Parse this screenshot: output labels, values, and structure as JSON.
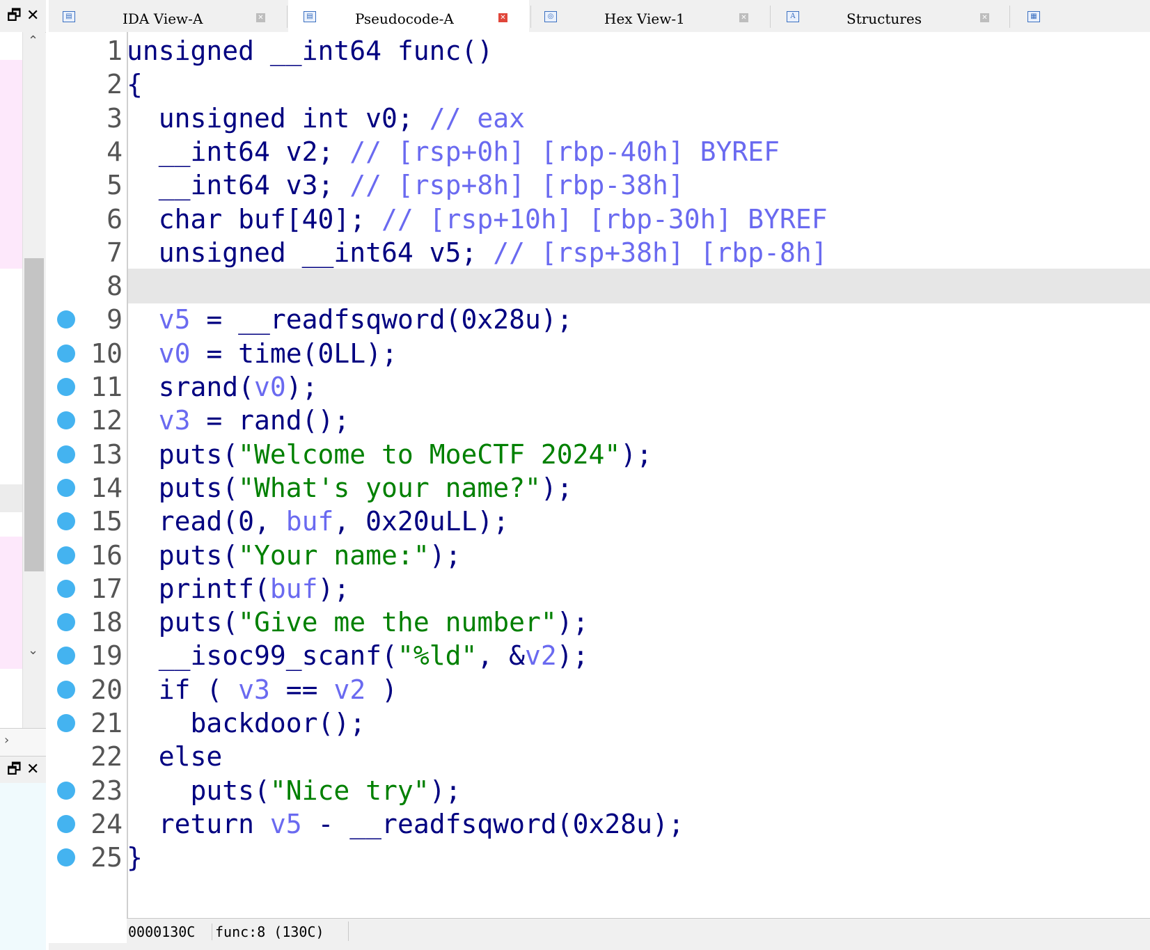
{
  "left_panel": {
    "restore_glyph": "🗗",
    "close_glyph": "✕",
    "scroll_up_glyph": "⌃",
    "scroll_down_glyph": "⌄",
    "scroll_right_glyph": "›"
  },
  "tabs": [
    {
      "label": "IDA View-A",
      "icon": "ida-view-icon",
      "active": false,
      "close_color": "#bdbdbd"
    },
    {
      "label": "Pseudocode-A",
      "icon": "pseudocode-icon",
      "active": true,
      "close_color": "#e0463a"
    },
    {
      "label": "Hex View-1",
      "icon": "hex-view-icon",
      "active": false,
      "close_color": "#bdbdbd"
    },
    {
      "label": "Structures",
      "icon": "structures-icon",
      "active": false,
      "close_color": "#bdbdbd"
    }
  ],
  "colors": {
    "keyword": "#000080",
    "variable": "#6a6af0",
    "string": "#008000",
    "breakpoint": "#44b3f0",
    "current_line": "#e6e6e6"
  },
  "code": {
    "current_line": 8,
    "lines": [
      {
        "n": "1",
        "bp": false,
        "tokens": [
          [
            "k",
            "unsigned __int64 func"
          ],
          [
            "k",
            "()"
          ]
        ]
      },
      {
        "n": "2",
        "bp": false,
        "tokens": [
          [
            "k",
            "{"
          ]
        ]
      },
      {
        "n": "3",
        "bp": false,
        "tokens": [
          [
            "k",
            "  unsigned int v0; "
          ],
          [
            "v",
            "// eax"
          ]
        ]
      },
      {
        "n": "4",
        "bp": false,
        "tokens": [
          [
            "k",
            "  __int64 v2; "
          ],
          [
            "v",
            "// [rsp+0h] [rbp-40h] BYREF"
          ]
        ]
      },
      {
        "n": "5",
        "bp": false,
        "tokens": [
          [
            "k",
            "  __int64 v3; "
          ],
          [
            "v",
            "// [rsp+8h] [rbp-38h]"
          ]
        ]
      },
      {
        "n": "6",
        "bp": false,
        "tokens": [
          [
            "k",
            "  char buf[40]; "
          ],
          [
            "v",
            "// [rsp+10h] [rbp-30h] BYREF"
          ]
        ]
      },
      {
        "n": "7",
        "bp": false,
        "tokens": [
          [
            "k",
            "  unsigned __int64 v5; "
          ],
          [
            "v",
            "// [rsp+38h] [rbp-8h]"
          ]
        ]
      },
      {
        "n": "8",
        "bp": false,
        "tokens": [
          [
            "k",
            ""
          ]
        ]
      },
      {
        "n": "9",
        "bp": true,
        "tokens": [
          [
            "k",
            "  "
          ],
          [
            "v",
            "v5"
          ],
          [
            "k",
            " = __readfsqword(0x28u);"
          ]
        ]
      },
      {
        "n": "10",
        "bp": true,
        "tokens": [
          [
            "k",
            "  "
          ],
          [
            "v",
            "v0"
          ],
          [
            "k",
            " = time(0LL);"
          ]
        ]
      },
      {
        "n": "11",
        "bp": true,
        "tokens": [
          [
            "k",
            "  srand("
          ],
          [
            "v",
            "v0"
          ],
          [
            "k",
            ");"
          ]
        ]
      },
      {
        "n": "12",
        "bp": true,
        "tokens": [
          [
            "k",
            "  "
          ],
          [
            "v",
            "v3"
          ],
          [
            "k",
            " = rand();"
          ]
        ]
      },
      {
        "n": "13",
        "bp": true,
        "tokens": [
          [
            "k",
            "  puts("
          ],
          [
            "s",
            "\"Welcome to MoeCTF 2024\""
          ],
          [
            "k",
            ");"
          ]
        ]
      },
      {
        "n": "14",
        "bp": true,
        "tokens": [
          [
            "k",
            "  puts("
          ],
          [
            "s",
            "\"What's your name?\""
          ],
          [
            "k",
            ");"
          ]
        ]
      },
      {
        "n": "15",
        "bp": true,
        "tokens": [
          [
            "k",
            "  read(0, "
          ],
          [
            "v",
            "buf"
          ],
          [
            "k",
            ", 0x20uLL);"
          ]
        ]
      },
      {
        "n": "16",
        "bp": true,
        "tokens": [
          [
            "k",
            "  puts("
          ],
          [
            "s",
            "\"Your name:\""
          ],
          [
            "k",
            ");"
          ]
        ]
      },
      {
        "n": "17",
        "bp": true,
        "tokens": [
          [
            "k",
            "  printf("
          ],
          [
            "v",
            "buf"
          ],
          [
            "k",
            ");"
          ]
        ]
      },
      {
        "n": "18",
        "bp": true,
        "tokens": [
          [
            "k",
            "  puts("
          ],
          [
            "s",
            "\"Give me the number\""
          ],
          [
            "k",
            ");"
          ]
        ]
      },
      {
        "n": "19",
        "bp": true,
        "tokens": [
          [
            "k",
            "  __isoc99_scanf("
          ],
          [
            "s",
            "\"%ld\""
          ],
          [
            "k",
            ", &"
          ],
          [
            "v",
            "v2"
          ],
          [
            "k",
            ");"
          ]
        ]
      },
      {
        "n": "20",
        "bp": true,
        "tokens": [
          [
            "k",
            "  if ( "
          ],
          [
            "v",
            "v3"
          ],
          [
            "k",
            " == "
          ],
          [
            "v",
            "v2"
          ],
          [
            "k",
            " )"
          ]
        ]
      },
      {
        "n": "21",
        "bp": true,
        "tokens": [
          [
            "k",
            "    backdoor();"
          ]
        ]
      },
      {
        "n": "22",
        "bp": false,
        "tokens": [
          [
            "k",
            "  else"
          ]
        ]
      },
      {
        "n": "23",
        "bp": true,
        "tokens": [
          [
            "k",
            "    puts("
          ],
          [
            "s",
            "\"Nice try\""
          ],
          [
            "k",
            ");"
          ]
        ]
      },
      {
        "n": "24",
        "bp": true,
        "tokens": [
          [
            "k",
            "  return "
          ],
          [
            "v",
            "v5"
          ],
          [
            "k",
            " - __readfsqword(0x28u);"
          ]
        ]
      },
      {
        "n": "25",
        "bp": true,
        "tokens": [
          [
            "k",
            "}"
          ]
        ]
      }
    ]
  },
  "status": {
    "address": "0000130C",
    "location": "func:8 (130C)"
  }
}
